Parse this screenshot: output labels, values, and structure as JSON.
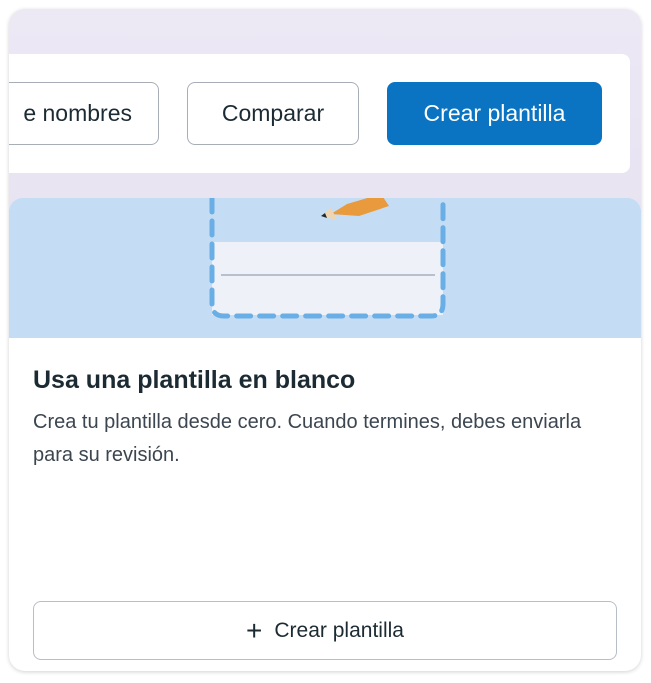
{
  "toolbar": {
    "names_button_label": "e nombres",
    "compare_button_label": "Comparar",
    "create_button_label": "Crear plantilla"
  },
  "blank_template_card": {
    "title": "Usa una plantilla en blanco",
    "description": "Crea tu plantilla desde cero. Cuando termines, debes enviarla para su revisión.",
    "button_label": "Crear plantilla",
    "button_icon": "plus-icon"
  },
  "colors": {
    "primary_button": "#0a74c2",
    "illustration_background": "#c4dcf4"
  }
}
